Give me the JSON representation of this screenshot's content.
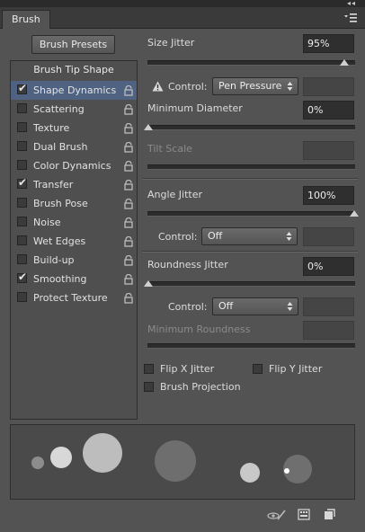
{
  "panel": {
    "tab_label": "Brush",
    "collapse_glyph": "◂◂",
    "close_glyph": "✕",
    "menu_icon": "panel-menu-icon"
  },
  "brush_presets_label": "Brush Presets",
  "brush_tip_shape_label": "Brush Tip Shape",
  "options": [
    {
      "label": "Shape Dynamics",
      "checked": true,
      "selected": true
    },
    {
      "label": "Scattering",
      "checked": false
    },
    {
      "label": "Texture",
      "checked": false
    },
    {
      "label": "Dual Brush",
      "checked": false
    },
    {
      "label": "Color Dynamics",
      "checked": false
    },
    {
      "label": "Transfer",
      "checked": true
    },
    {
      "label": "Brush Pose",
      "checked": false
    },
    {
      "label": "Noise",
      "checked": false
    },
    {
      "label": "Wet Edges",
      "checked": false
    },
    {
      "label": "Build-up",
      "checked": false
    },
    {
      "label": "Smoothing",
      "checked": true
    },
    {
      "label": "Protect Texture",
      "checked": false
    }
  ],
  "settings": {
    "size_jitter": {
      "label": "Size Jitter",
      "value": "95%",
      "level": 0.95
    },
    "control_1": {
      "label": "Control:",
      "value": "Pen Pressure",
      "warning_icon": "warning-icon"
    },
    "minimum_diameter": {
      "label": "Minimum Diameter",
      "value": "0%",
      "level": 0.0
    },
    "tilt_scale": {
      "label": "Tilt Scale"
    },
    "angle_jitter": {
      "label": "Angle Jitter",
      "value": "100%",
      "level": 1.0
    },
    "control_2": {
      "label": "Control:",
      "value": "Off"
    },
    "roundness_jitter": {
      "label": "Roundness Jitter",
      "value": "0%",
      "level": 0.0
    },
    "control_3": {
      "label": "Control:",
      "value": "Off"
    },
    "minimum_roundness": {
      "label": "Minimum Roundness"
    },
    "flip_x": {
      "label": "Flip X Jitter",
      "checked": false
    },
    "flip_y": {
      "label": "Flip Y Jitter",
      "checked": false
    },
    "brush_projection": {
      "label": "Brush Projection",
      "checked": false
    }
  },
  "colors": {
    "selection": "#4f6282",
    "panel_bg": "#535353"
  },
  "footer_icons": [
    "toggle-live-tip-preview-icon",
    "open-brush-editor-icon",
    "create-new-brush-icon"
  ]
}
